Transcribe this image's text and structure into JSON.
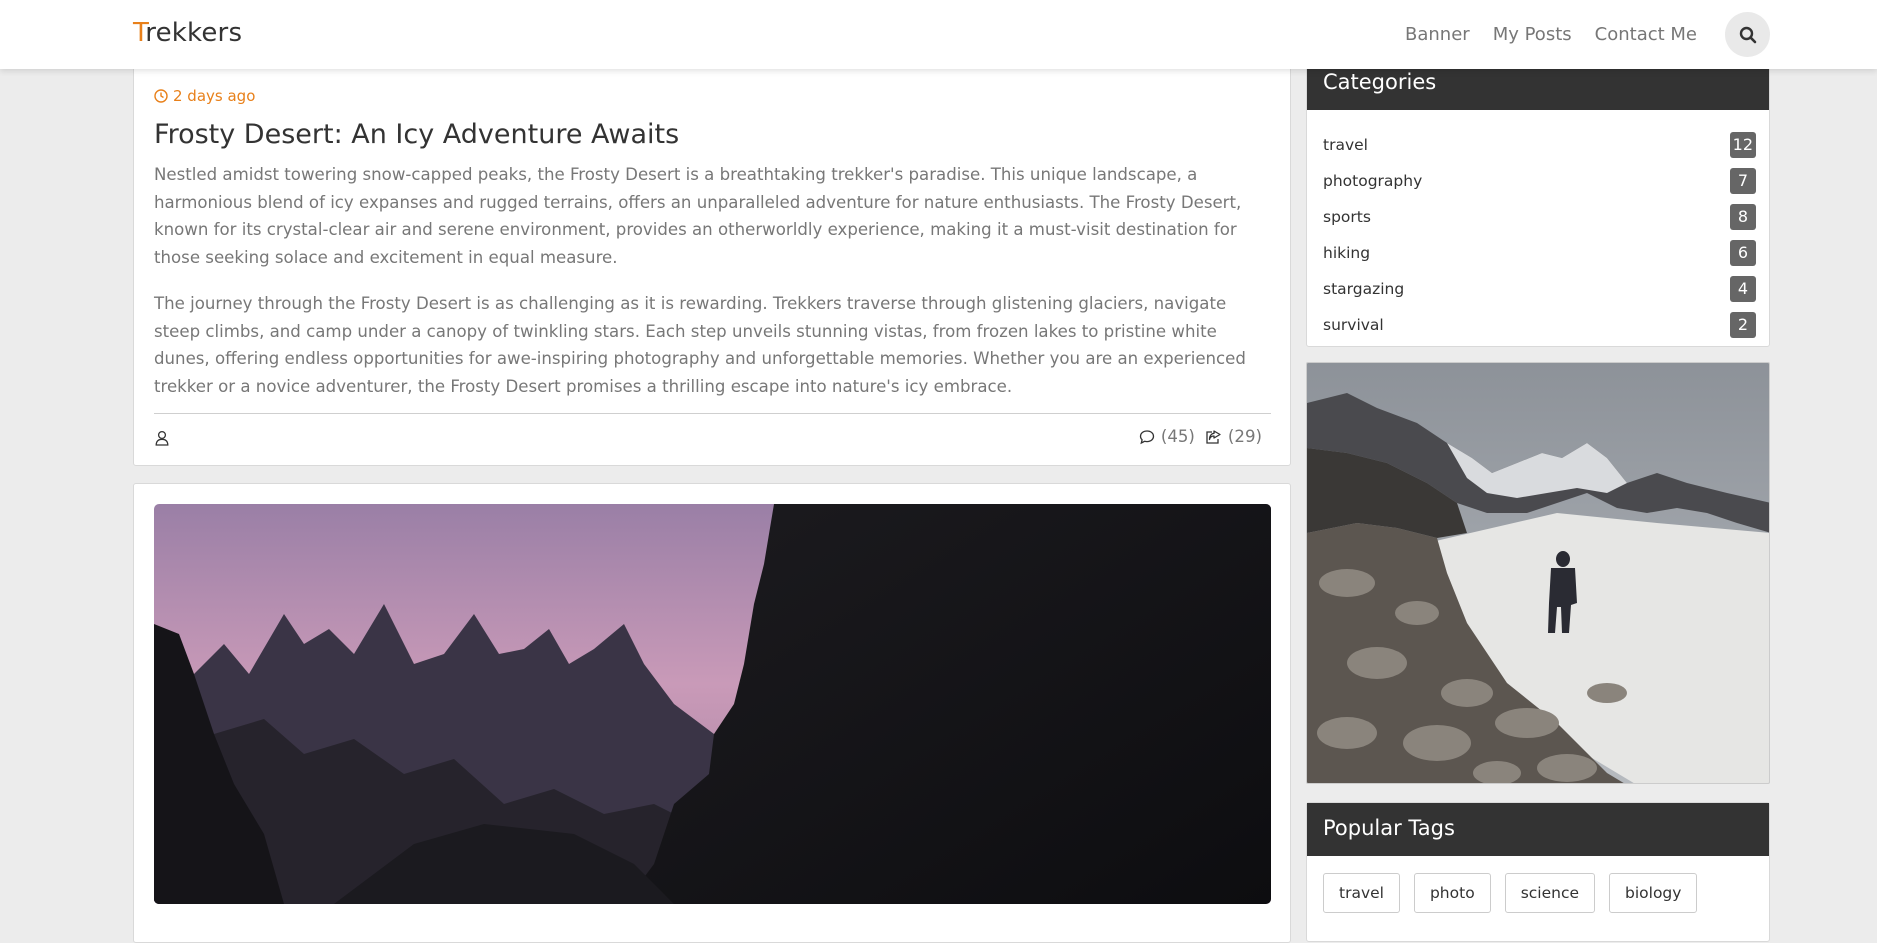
{
  "navbar": {
    "brand_first": "T",
    "brand_rest": "rekkers",
    "links": [
      "Banner",
      "My Posts",
      "Contact Me"
    ],
    "search_icon": "search-icon"
  },
  "post": {
    "timestamp": "2 days ago",
    "title": "Frosty Desert: An Icy Adventure Awaits",
    "paragraphs": [
      "Nestled amidst towering snow-capped peaks, the Frosty Desert is a breathtaking trekker's paradise. This unique landscape, a harmonious blend of icy expanses and rugged terrains, offers an unparalleled adventure for nature enthusiasts. The Frosty Desert, known for its crystal-clear air and serene environment, provides an otherworldly experience, making it a must-visit destination for those seeking solace and excitement in equal measure.",
      "The journey through the Frosty Desert is as challenging as it is rewarding. Trekkers traverse through glistening glaciers, navigate steep climbs, and camp under a canopy of twinkling stars. Each step unveils stunning vistas, from frozen lakes to pristine white dunes, offering endless opportunities for awe-inspiring photography and unforgettable memories. Whether you are an experienced trekker or a novice adventurer, the Frosty Desert promises a thrilling escape into nature's icy embrace."
    ],
    "comments": "(45)",
    "shares": "(29)"
  },
  "sidebar": {
    "categories_title": "Categories",
    "categories": [
      {
        "name": "travel",
        "count": "12"
      },
      {
        "name": "photography",
        "count": "7"
      },
      {
        "name": "sports",
        "count": "8"
      },
      {
        "name": "hiking",
        "count": "6"
      },
      {
        "name": "stargazing",
        "count": "4"
      },
      {
        "name": "survival",
        "count": "2"
      }
    ],
    "tags_title": "Popular Tags",
    "tags": [
      "travel",
      "photo",
      "science",
      "biology"
    ]
  },
  "colors": {
    "accent": "#e8801a",
    "widget_header": "#333333",
    "badge": "#666666",
    "background": "#ececec"
  }
}
